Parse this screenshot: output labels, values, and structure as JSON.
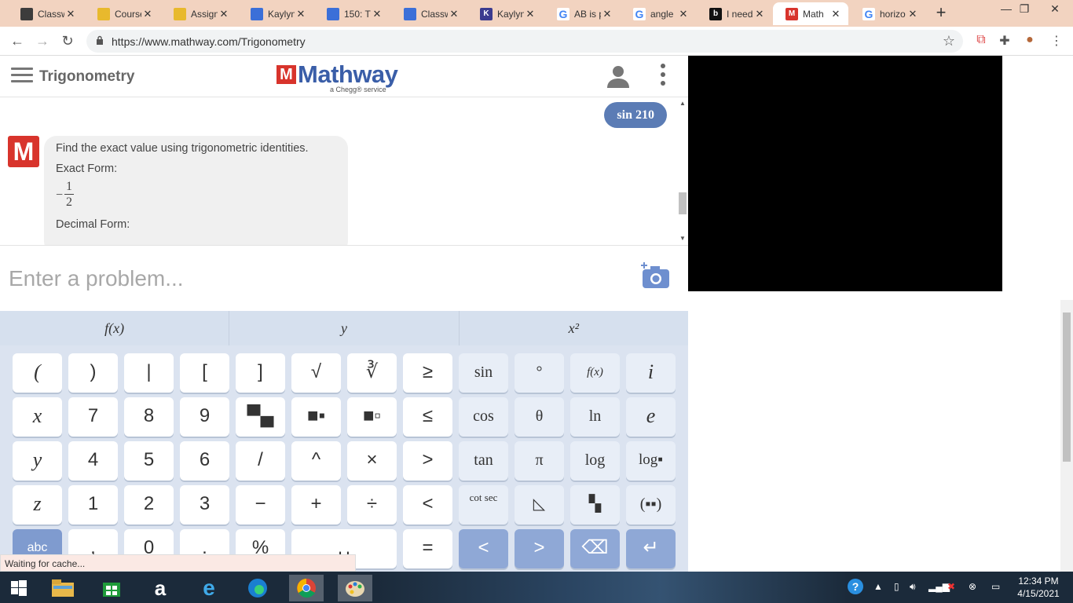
{
  "browser": {
    "tabs": [
      {
        "title": "Classw",
        "favicon_color": "#3c3c3c",
        "favicon_letter": ""
      },
      {
        "title": "Course",
        "favicon_color": "#e8b92d",
        "favicon_letter": ""
      },
      {
        "title": "Assign",
        "favicon_color": "#e8b92d",
        "favicon_letter": ""
      },
      {
        "title": "Kaylyn",
        "favicon_color": "#3b6fd8",
        "favicon_letter": ""
      },
      {
        "title": "150: T",
        "favicon_color": "#3b6fd8",
        "favicon_letter": ""
      },
      {
        "title": "Classw",
        "favicon_color": "#3b6fd8",
        "favicon_letter": ""
      },
      {
        "title": "Kaylyn",
        "favicon_color": "#3b3b8f",
        "favicon_letter": "K"
      },
      {
        "title": "AB is p",
        "favicon_color": "#ffffff",
        "favicon_letter": "G"
      },
      {
        "title": "angle",
        "favicon_color": "#ffffff",
        "favicon_letter": "G"
      },
      {
        "title": "I need",
        "favicon_color": "#111111",
        "favicon_letter": "b"
      },
      {
        "title": "Math",
        "favicon_color": "#d8342c",
        "favicon_letter": "M"
      },
      {
        "title": "horizo",
        "favicon_color": "#ffffff",
        "favicon_letter": "G"
      }
    ],
    "active_tab_index": 10,
    "url": "https://www.mathway.com/Trigonometry",
    "new_tab_symbol": "+",
    "window_controls": {
      "minimize": "—",
      "restore": "❐",
      "close": "✕"
    }
  },
  "app": {
    "title": "Trigonometry",
    "logo": {
      "mark": "M",
      "word": "Mathway",
      "subtitle": "a Chegg® service"
    },
    "chat": {
      "user_message": "sin 210",
      "bot_avatar": "M",
      "bot_intro": "Find the exact value using trigonometric identities.",
      "exact_label": "Exact Form:",
      "exact_sign": "−",
      "exact_numerator": "1",
      "exact_denominator": "2",
      "decimal_label": "Decimal Form:"
    },
    "input_placeholder": "Enter a problem...",
    "keypad_tabs": [
      "f(x)",
      "y",
      "x²"
    ],
    "keys": {
      "row1": [
        "(",
        ")",
        "|",
        "[",
        "]",
        "√",
        "∛",
        "≥",
        "sin",
        "°",
        "f(x)",
        "i"
      ],
      "row2": [
        "x",
        "7",
        "8",
        "9",
        "▀▄",
        "■▪",
        "■▫",
        "≤",
        "cos",
        "θ",
        "ln",
        "e"
      ],
      "row3": [
        "y",
        "4",
        "5",
        "6",
        "/",
        "^",
        "×",
        ">",
        "tan",
        "π",
        "log",
        "log▪"
      ],
      "row4": [
        "z",
        "1",
        "2",
        "3",
        "−",
        "+",
        "÷",
        "<",
        "cot sec",
        "◺",
        "▚",
        "(▪▪)"
      ],
      "row5": [
        "abc",
        ",",
        "0",
        ".",
        "%",
        "␣",
        "=",
        "<",
        ">",
        "⌫",
        "↵"
      ]
    }
  },
  "status_text": "Waiting for cache...",
  "taskbar": {
    "time": "12:34 PM",
    "date": "4/15/2021"
  }
}
